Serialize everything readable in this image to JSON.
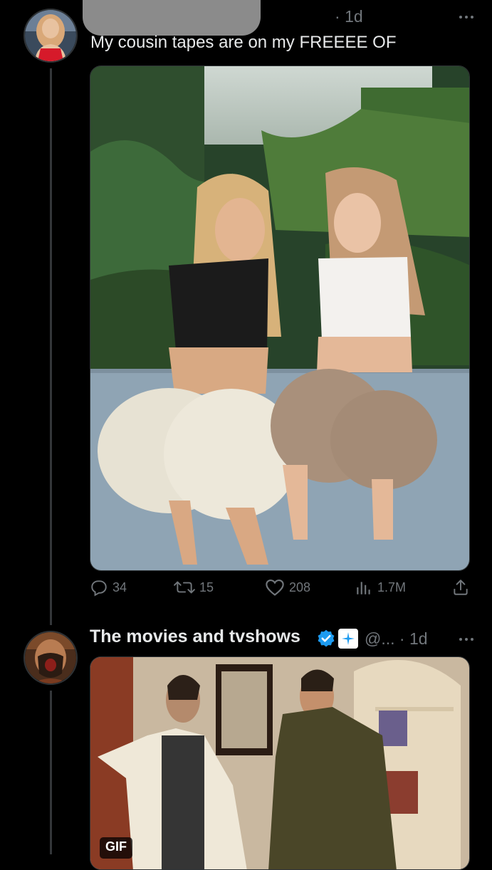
{
  "tweet1": {
    "time": "1d",
    "text": "My cousin tapes are on my FREEEE OF",
    "photo_alt": "two women posing in shorts in a garden",
    "actions": {
      "replies": "34",
      "retweets": "15",
      "likes": "208",
      "views": "1.7M"
    }
  },
  "tweet2": {
    "display_name": "The movies and tvshows",
    "handle": "@...",
    "time": "· 1d",
    "verified_color": "#1d9bf0",
    "badge_label": "GIF"
  },
  "icons": [
    "more-icon",
    "reply-icon",
    "retweet-icon",
    "like-icon",
    "views-icon",
    "share-icon",
    "verified-icon",
    "affiliate-badge-icon"
  ]
}
